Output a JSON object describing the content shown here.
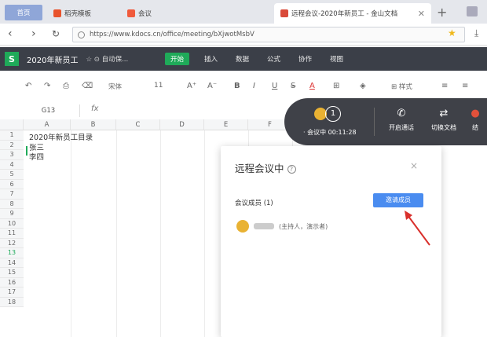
{
  "browser": {
    "tabs": [
      {
        "label": "首页"
      },
      {
        "label": "稻壳模板"
      },
      {
        "label": "会议"
      },
      {
        "label": "远程会议-2020年新员工 - 金山文档"
      }
    ],
    "url": "https://www.kdocs.cn/office/meeting/bXjwotMsbV"
  },
  "app": {
    "logo": "S",
    "doc_title": "2020年新员工",
    "autosave": "☆ ⊙ 自动保...",
    "menu": [
      "开始",
      "插入",
      "数据",
      "公式",
      "协作",
      "视图"
    ]
  },
  "toolbar": {
    "font": "宋体",
    "size": "11",
    "style_label": "样式"
  },
  "formula": {
    "cell_ref": "G13",
    "fx": "fx"
  },
  "grid": {
    "columns": [
      "A",
      "B",
      "C",
      "D",
      "E",
      "F"
    ],
    "rows": [
      "1",
      "2",
      "3",
      "4",
      "5",
      "6",
      "7",
      "8",
      "9",
      "10",
      "11",
      "12",
      "13",
      "14",
      "15",
      "16",
      "17",
      "18"
    ],
    "cells": [
      {
        "row": 1,
        "text": "2020年新员工目录"
      },
      {
        "row": 2,
        "text": "张三"
      },
      {
        "row": 3,
        "text": "李四"
      }
    ]
  },
  "meeting_bar": {
    "count": "1",
    "status": "· 会议中 00:11:28",
    "buttons": [
      {
        "label": "开启通话",
        "icon": "phone-icon"
      },
      {
        "label": "切换文档",
        "icon": "switch-doc-icon"
      },
      {
        "label": "结",
        "icon": "end-icon"
      }
    ]
  },
  "dialog": {
    "title": "远程会议中",
    "help": "?",
    "close": "×",
    "members_label": "会议成员 (1)",
    "invite_label": "邀请成员",
    "member_role": "(主持人，演示者)"
  },
  "colors": {
    "accent_green": "#1faa59",
    "invite_blue": "#4a8cf0",
    "arrow_red": "#d9302c",
    "header_dark": "#3b3f48"
  }
}
